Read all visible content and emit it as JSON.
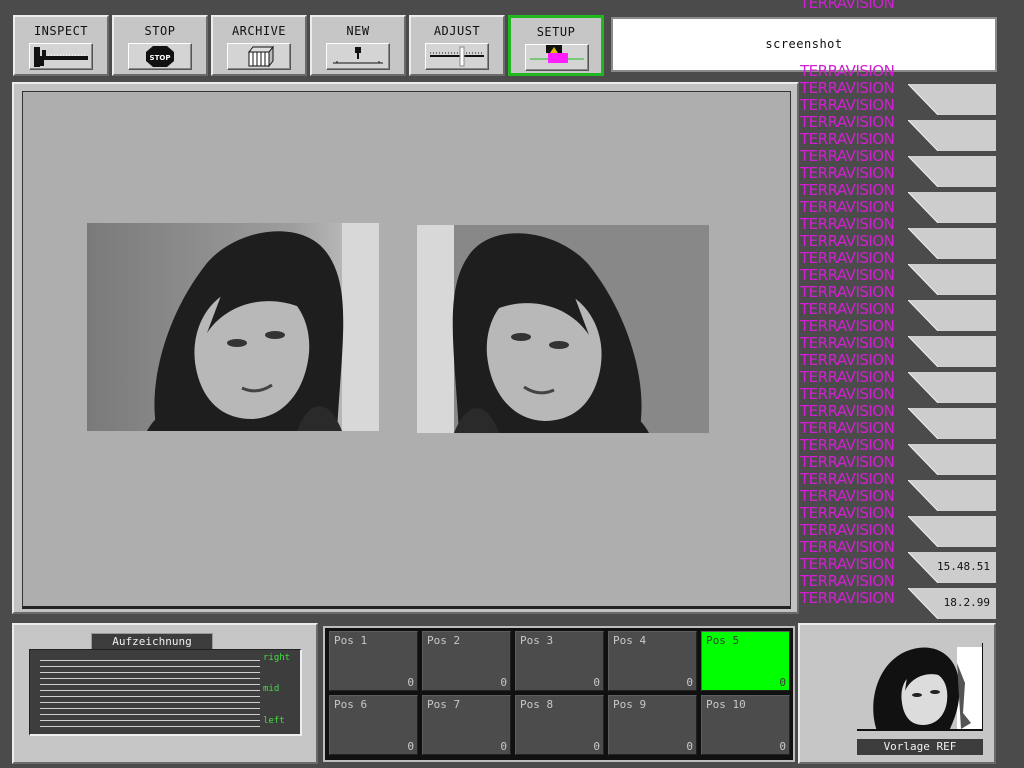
{
  "toolbar": {
    "buttons": [
      {
        "label": "INSPECT",
        "icon": "caliper-icon"
      },
      {
        "label": "STOP",
        "icon": "stop-sign-icon",
        "icon_text": "STOP"
      },
      {
        "label": "ARCHIVE",
        "icon": "archive-boxes-icon"
      },
      {
        "label": "NEW",
        "icon": "new-plunger-icon"
      },
      {
        "label": "ADJUST",
        "icon": "adjust-slider-icon"
      },
      {
        "label": "SETUP",
        "icon": "setup-meter-icon",
        "active": true
      }
    ],
    "title_value": "screenshot"
  },
  "brand": {
    "text": "TERRAVISION",
    "color": "#d21fd2",
    "repeat_count": 36
  },
  "viewer": {
    "photos": [
      {
        "name": "portrait-photo-original",
        "mirrored": false
      },
      {
        "name": "portrait-photo-mirrored",
        "mirrored": true
      }
    ]
  },
  "side_slots": {
    "empty_count": 13,
    "time": "15.48.51",
    "date": "18.2.99"
  },
  "recording": {
    "title": "Aufzeichnung",
    "labels": {
      "right": "right",
      "mid": "mid",
      "left": "left"
    },
    "line_count": 12
  },
  "positions": [
    {
      "name": "Pos 1",
      "count": "0",
      "active": false
    },
    {
      "name": "Pos 2",
      "count": "0",
      "active": false
    },
    {
      "name": "Pos 3",
      "count": "0",
      "active": false
    },
    {
      "name": "Pos 4",
      "count": "0",
      "active": false
    },
    {
      "name": "Pos 5",
      "count": "0",
      "active": true
    },
    {
      "name": "Pos 6",
      "count": "0",
      "active": false
    },
    {
      "name": "Pos 7",
      "count": "0",
      "active": false
    },
    {
      "name": "Pos 8",
      "count": "0",
      "active": false
    },
    {
      "name": "Pos 9",
      "count": "0",
      "active": false
    },
    {
      "name": "Pos 10",
      "count": "0",
      "active": false
    }
  ],
  "reference": {
    "label": "Vorlage REF"
  },
  "colors": {
    "active_green": "#00ff00",
    "active_border": "#1fb81f",
    "accent_magenta": "#d21fd2"
  }
}
